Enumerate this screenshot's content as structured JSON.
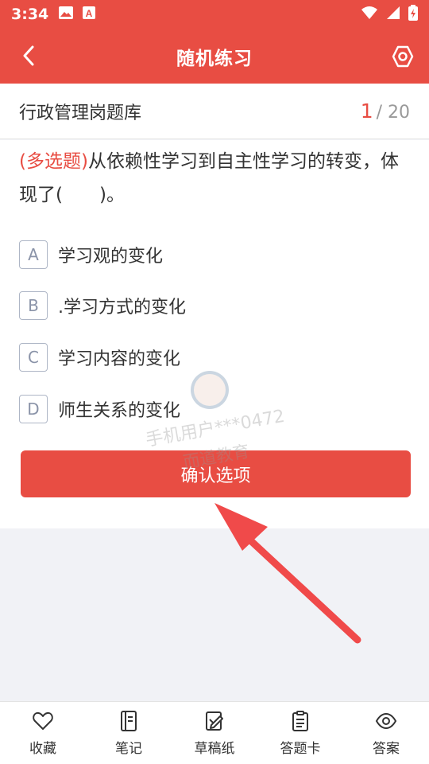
{
  "status_bar": {
    "time": "3:34",
    "icons": [
      "image-icon",
      "font-icon",
      "wifi-icon",
      "signal-icon",
      "battery-icon"
    ]
  },
  "app_bar": {
    "title": "随机练习",
    "back_icon": "chevron-left-icon",
    "settings_icon": "settings-icon"
  },
  "bank": {
    "name": "行政管理岗题库",
    "current": "1",
    "total": "/ 20"
  },
  "question": {
    "type": "(多选题)",
    "text": "从依赖性学习到自主性学习的转变，体现了(　　)。"
  },
  "options": [
    {
      "letter": "A",
      "text": "学习观的变化"
    },
    {
      "letter": "B",
      "text": ".学习方式的变化"
    },
    {
      "letter": "C",
      "text": "学习内容的变化"
    },
    {
      "letter": "D",
      "text": "师生关系的变化"
    }
  ],
  "confirm_label": "确认选项",
  "watermark": {
    "user": "手机用户***0472",
    "brand": "而道教育"
  },
  "bottom_nav": [
    {
      "label": "收藏",
      "icon": "heart-icon"
    },
    {
      "label": "笔记",
      "icon": "notebook-icon"
    },
    {
      "label": "草稿纸",
      "icon": "draft-icon"
    },
    {
      "label": "答题卡",
      "icon": "clipboard-icon"
    },
    {
      "label": "答案",
      "icon": "eye-icon"
    }
  ],
  "colors": {
    "primary": "#e84d43",
    "option_border": "#aeb6c6",
    "background": "#f1f2f6"
  }
}
